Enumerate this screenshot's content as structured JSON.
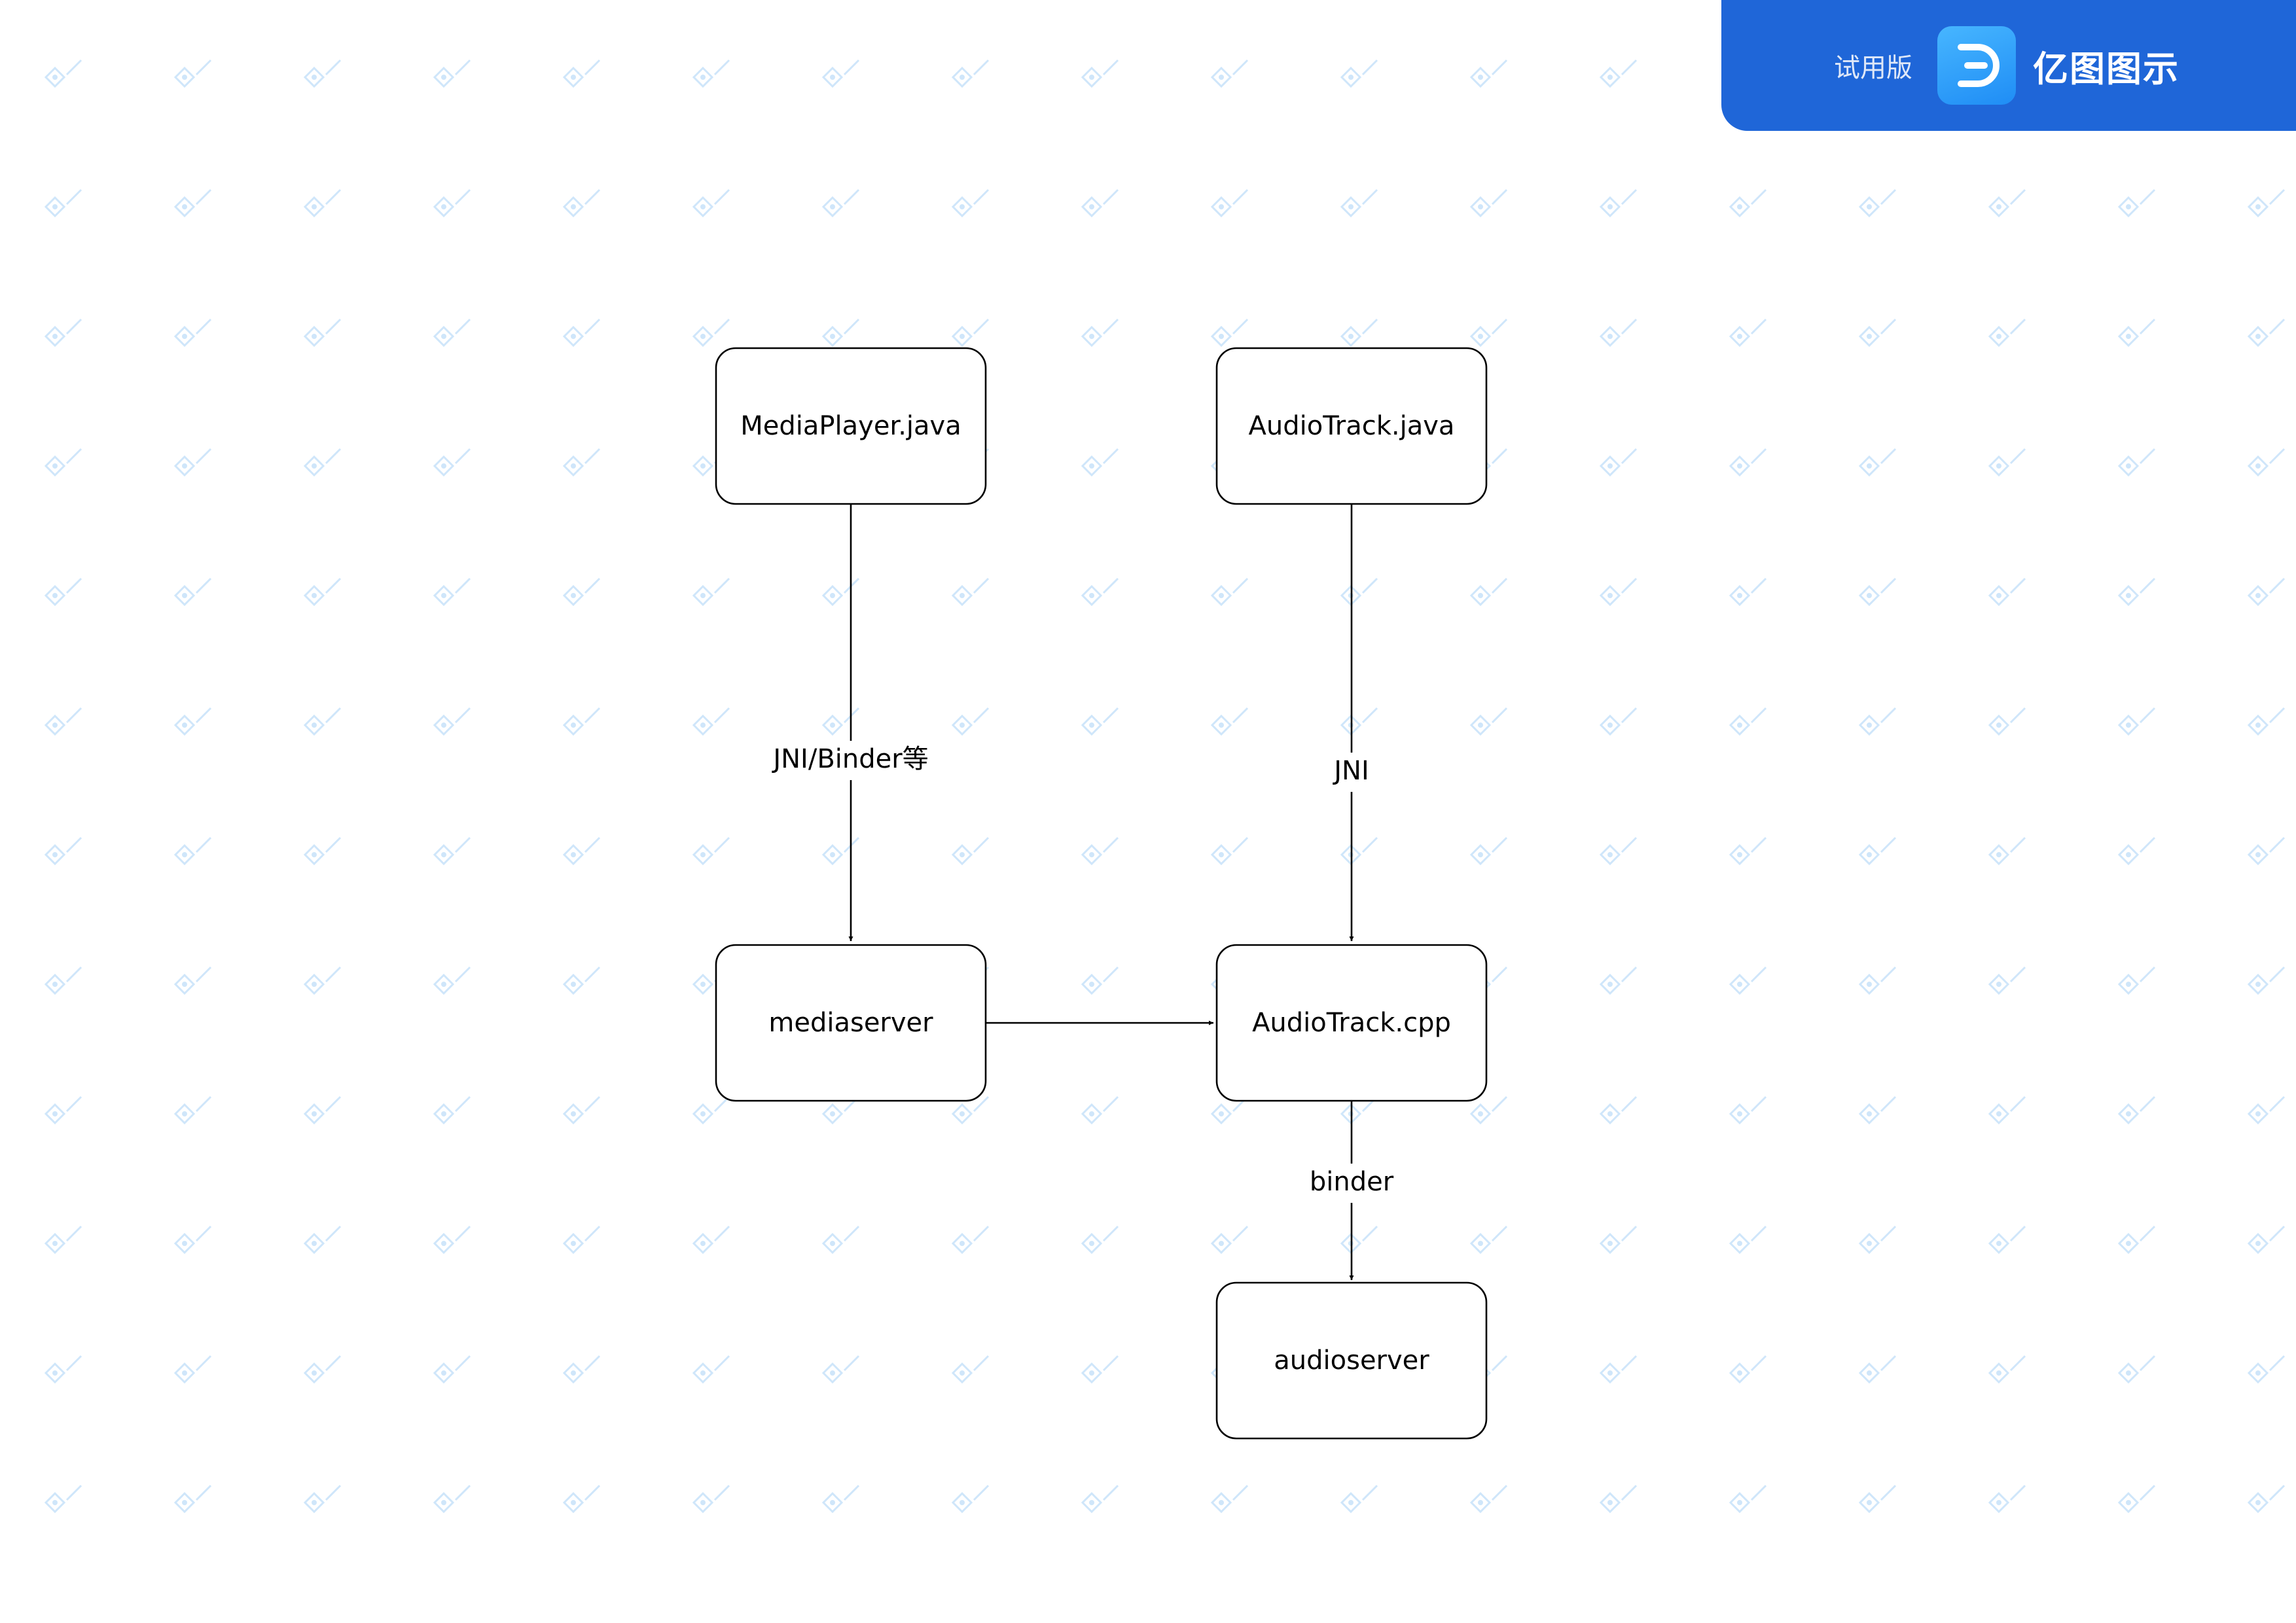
{
  "banner": {
    "trial_label": "试用版",
    "brand_name": "亿图图示",
    "background_color": "#1f66d8",
    "logo_icon": "edraw-logo-icon"
  },
  "watermark": {
    "icon": "edraw-watermark-icon",
    "color": "#cfe6fa"
  },
  "diagram": {
    "nodes": {
      "mediaplayer_java": {
        "label": "MediaPlayer.java"
      },
      "audiotrack_java": {
        "label": "AudioTrack.java"
      },
      "mediaserver": {
        "label": "mediaserver"
      },
      "audiotrack_cpp": {
        "label": "AudioTrack.cpp"
      },
      "audioserver": {
        "label": "audioserver"
      }
    },
    "edges": [
      {
        "from": "MediaPlayer.java",
        "to": "mediaserver",
        "label": "JNI/Binder等"
      },
      {
        "from": "AudioTrack.java",
        "to": "AudioTrack.cpp",
        "label": "JNI"
      },
      {
        "from": "mediaserver",
        "to": "AudioTrack.cpp",
        "label": ""
      },
      {
        "from": "AudioTrack.cpp",
        "to": "audioserver",
        "label": "binder"
      }
    ]
  }
}
